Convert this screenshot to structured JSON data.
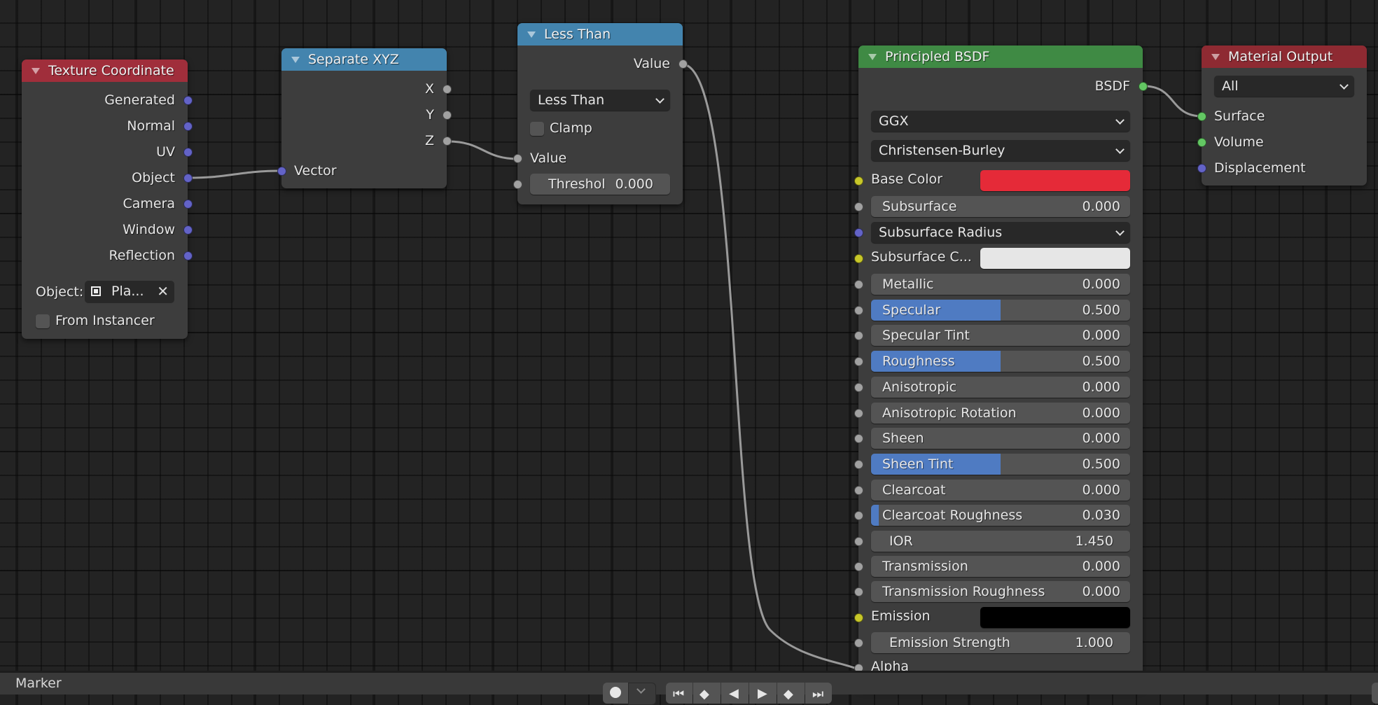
{
  "nodes": {
    "texture_coordinate": {
      "title": "Texture Coordinate",
      "outputs": [
        "Generated",
        "Normal",
        "UV",
        "Object",
        "Camera",
        "Window",
        "Reflection"
      ],
      "object_label": "Object:",
      "object_value": "Pla...",
      "from_instancer_label": "From Instancer",
      "from_instancer_checked": false
    },
    "separate_xyz": {
      "title": "Separate XYZ",
      "outputs": [
        "X",
        "Y",
        "Z"
      ],
      "inputs": [
        "Vector"
      ]
    },
    "less_than": {
      "title": "Less Than",
      "output": "Value",
      "operation": "Less Than",
      "clamp_label": "Clamp",
      "clamp_checked": false,
      "input_value_label": "Value",
      "threshold_label": "Threshol",
      "threshold_value": "0.000"
    },
    "principled_bsdf": {
      "title": "Principled BSDF",
      "output": "BSDF",
      "distribution": "GGX",
      "subsurface_method": "Christensen-Burley",
      "base_color_label": "Base Color",
      "base_color": "#e52a38",
      "subsurface_label": "Subsurface",
      "subsurface_value": "0.000",
      "subsurface_radius_label": "Subsurface Radius",
      "subsurface_color_label": "Subsurface C...",
      "subsurface_color": "#e6e6e6",
      "sliders": [
        {
          "label": "Metallic",
          "value": "0.000",
          "fraction": 0.0
        },
        {
          "label": "Specular",
          "value": "0.500",
          "fraction": 0.5
        },
        {
          "label": "Specular Tint",
          "value": "0.000",
          "fraction": 0.0
        },
        {
          "label": "Roughness",
          "value": "0.500",
          "fraction": 0.5
        },
        {
          "label": "Anisotropic",
          "value": "0.000",
          "fraction": 0.0
        },
        {
          "label": "Anisotropic Rotation",
          "value": "0.000",
          "fraction": 0.0
        },
        {
          "label": "Sheen",
          "value": "0.000",
          "fraction": 0.0
        },
        {
          "label": "Sheen Tint",
          "value": "0.500",
          "fraction": 0.5
        },
        {
          "label": "Clearcoat",
          "value": "0.000",
          "fraction": 0.0
        },
        {
          "label": "Clearcoat Roughness",
          "value": "0.030",
          "fraction": 0.03
        }
      ],
      "ior_label": "IOR",
      "ior_value": "1.450",
      "transmission_label": "Transmission",
      "transmission_value": "0.000",
      "transmission_roughness_label": "Transmission Roughness",
      "transmission_roughness_value": "0.000",
      "emission_label": "Emission",
      "emission_color": "#000000",
      "emission_strength_label": "Emission Strength",
      "emission_strength_value": "1.000",
      "alpha_label": "Alpha"
    },
    "material_output": {
      "title": "Material Output",
      "target": "All",
      "inputs": [
        "Surface",
        "Volume",
        "Displacement"
      ]
    }
  },
  "timeline": {
    "marker_label": "Marker"
  },
  "colors": {
    "socket_vector": "#6363c7",
    "socket_float": "#a1a1a1",
    "socket_color": "#c7c729",
    "socket_shader": "#63c763",
    "slider_fill": "#4f7bc2"
  }
}
